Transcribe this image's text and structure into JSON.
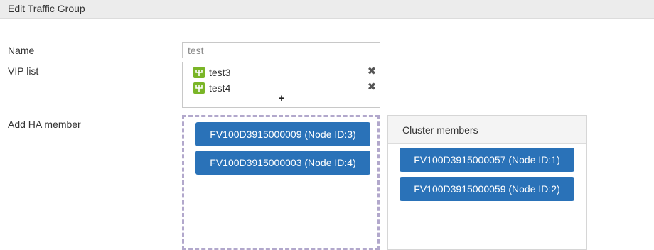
{
  "header": {
    "title": "Edit Traffic Group"
  },
  "form": {
    "name_label": "Name",
    "name_value": "test",
    "vip_label": "VIP list",
    "vip_items": [
      {
        "label": "test3",
        "icon": "vip-icon",
        "remove_icon": "close-icon"
      },
      {
        "label": "test4",
        "icon": "vip-icon",
        "remove_icon": "close-icon"
      }
    ],
    "vip_add_icon": "plus-icon",
    "remove_glyph": "✖",
    "add_glyph": "+",
    "ha_label": "Add HA member"
  },
  "available_members": [
    {
      "label": "FV100D3915000009 (Node ID:3)"
    },
    {
      "label": "FV100D3915000003 (Node ID:4)"
    }
  ],
  "cluster": {
    "title": "Cluster members",
    "members": [
      {
        "label": "FV100D3915000057 (Node ID:1)"
      },
      {
        "label": "FV100D3915000059 (Node ID:2)"
      }
    ]
  },
  "colors": {
    "member_button": "#2a72b8",
    "vip_icon": "#7ab527",
    "drop_border": "#b2a8cc",
    "header_bg": "#ececec"
  }
}
